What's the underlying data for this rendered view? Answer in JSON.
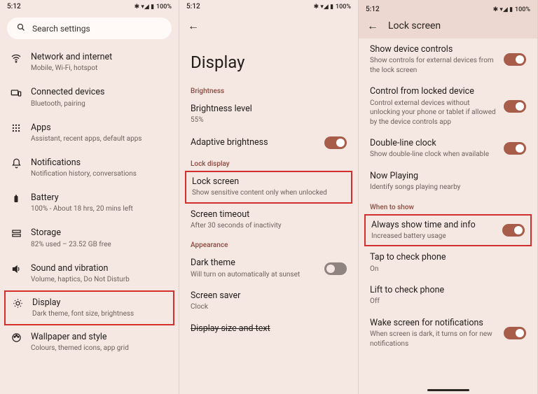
{
  "status": {
    "time": "5:12",
    "icons": "✱ ▾◢ ▮",
    "battery": "100%"
  },
  "panel1": {
    "search_placeholder": "Search settings",
    "items": [
      {
        "icon": "wifi",
        "title": "Network and internet",
        "sub": "Mobile, Wi-Fi, hotspot"
      },
      {
        "icon": "devices",
        "title": "Connected devices",
        "sub": "Bluetooth, pairing"
      },
      {
        "icon": "apps",
        "title": "Apps",
        "sub": "Assistant, recent apps, default apps"
      },
      {
        "icon": "bell",
        "title": "Notifications",
        "sub": "Notification history, conversations"
      },
      {
        "icon": "battery",
        "title": "Battery",
        "sub": "100% - About 18 hrs, 20 mins left"
      },
      {
        "icon": "storage",
        "title": "Storage",
        "sub": "82% used – 23.52 GB free"
      },
      {
        "icon": "sound",
        "title": "Sound and vibration",
        "sub": "Volume, haptics, Do Not Disturb"
      },
      {
        "icon": "display",
        "title": "Display",
        "sub": "Dark theme, font size, brightness"
      },
      {
        "icon": "wallpaper",
        "title": "Wallpaper and style",
        "sub": "Colours, themed icons, app grid"
      }
    ]
  },
  "panel2": {
    "title": "Display",
    "sec_brightness": "Brightness",
    "brightness_level": {
      "title": "Brightness level",
      "sub": "55%"
    },
    "adaptive": {
      "title": "Adaptive brightness",
      "on": true
    },
    "sec_lock": "Lock display",
    "lock_screen": {
      "title": "Lock screen",
      "sub": "Show sensitive content only when unlocked"
    },
    "screen_timeout": {
      "title": "Screen timeout",
      "sub": "After 30 seconds of inactivity"
    },
    "sec_appearance": "Appearance",
    "dark_theme": {
      "title": "Dark theme",
      "sub": "Will turn on automatically at sunset",
      "on": false
    },
    "screen_saver": {
      "title": "Screen saver",
      "sub": "Clock"
    },
    "display_size": {
      "title": "Display size and text"
    }
  },
  "panel3": {
    "header": "Lock screen",
    "device_controls": {
      "title": "Show device controls",
      "sub": "Show controls for external devices from the lock screen",
      "on": true
    },
    "locked_device": {
      "title": "Control from locked device",
      "sub": "Control external devices without unlocking your phone or tablet if allowed by the device controls app",
      "on": true
    },
    "double_clock": {
      "title": "Double-line clock",
      "sub": "Show double-line clock when available",
      "on": true
    },
    "now_playing": {
      "title": "Now Playing",
      "sub": "Identify songs playing nearby"
    },
    "sec_when": "When to show",
    "always_show": {
      "title": "Always show time and info",
      "sub": "Increased battery usage",
      "on": true
    },
    "tap_check": {
      "title": "Tap to check phone",
      "sub": "On"
    },
    "lift_check": {
      "title": "Lift to check phone",
      "sub": "Off"
    },
    "wake_notif": {
      "title": "Wake screen for notifications",
      "sub": "When screen is dark, it turns on for new notifications",
      "on": true
    }
  }
}
